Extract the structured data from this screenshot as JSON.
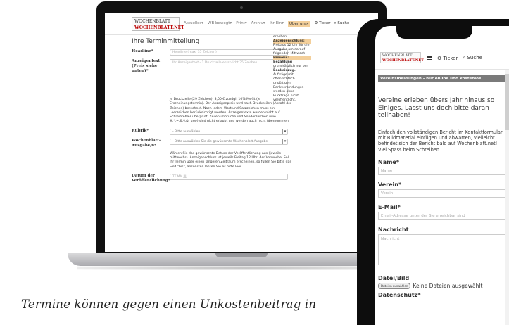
{
  "laptop": {
    "logo": [
      "WOCHENBLATT",
      "WOCHENBLATT.NET"
    ],
    "nav": [
      "Aktuelles▾",
      "WB bewegt▾",
      "Print▾",
      "Archiv▾",
      "Ihr Ein▾",
      "Uber uns▾"
    ],
    "nav_right": [
      "⚙ Ticker",
      "⌕ Suche"
    ],
    "form_title": "Ihre Terminmitteilung",
    "headline_label": "Headline*",
    "headline_placeholder": "Headline (max. 35 Zeichen)",
    "anzeigentext_label": "Anzeigentext (Preis siehe unten)*",
    "anzeigentext_placeholder": "Ihr Anzeigentext - 1 Druckzeile entspricht 35 Zeichen",
    "help_price": "Je Druckzeile (29 Zeichen): 3,00 € zuzügl. 10% MwSt (je Erscheinungstermin). Der Anzeigenpreis wird nach Druckzeilen (Anzahl der Zeichen) berechnet. Nach jedem Wort und Satzzeichen muss ein Leerzeichen berücksichtigt werden. Anzeigentexte werden nicht auf Schreibfehler überprüft. Zeilenumbrüche und Sonderzeichen (wie #,*,~,&,§,&, usw) sind nicht erlaubt und werden auch nicht übernommen.",
    "rubrik_label": "Rubrik*",
    "rubrik_value": "- Bitte auswählen",
    "ausgabe_label": "Wochenblatt-Ausgabe/n*",
    "ausgabe_value": "- Bitte auswählen Sie die gewünschte Wochenblatt Ausgabe -",
    "help_date": "Wählen Sie das gewünschte Datum der Veröffentlichung aus (jeweils mittwochs). Anzeigenschluss ist jeweils Freitag 12 Uhr, der Vorwoche. Soll Ihr Termin über einen längeren Zeitraum erscheinen, so füllen Sie bitte das Feld \"bis\", ansonsten lassen Sie es bitte leer.",
    "datum_label": "Datum der Veröffentlichung*",
    "datum_placeholder": "TT.MM.JJJJ",
    "side": {
      "intro": "erhoben.",
      "schluss_label": "Anzeigenschluss:",
      "schluss_text": "Freitags 12 Uhr für die Ausgabe am darauf folgenden Mittwoch",
      "hinweis_label": "Hinweis:",
      "hinweis_head": "Bezahlung",
      "hinweis_text": "grundsätzlich nur per",
      "einzug": "Bankeinzug.",
      "rest": "Aufträge mit offensichtlich ungültigen Bankverbindungen werden ohne Rückfrage nicht veröffentlicht."
    }
  },
  "phone": {
    "logo": [
      "WOCHENBLATT",
      "WOCHENBLATT.NET"
    ],
    "nav_ticker": "⚙ Ticker",
    "nav_suche": "⌕ Suche",
    "banner": "Vereinsmeldungen - nur online und kostenlos",
    "intro": "Vereine erleben übers Jahr hinaus so Einiges. Lasst uns doch bitte daran teilhaben!",
    "detail": "Einfach den vollständigen Bericht im Kontaktformular mit Bildmaterial einfügen und abwarten, vielleicht befindet sich der Bericht bald auf Wochenblatt.net! Viel Spass beim Schreiben.",
    "name_label": "Name*",
    "name_placeholder": "Name",
    "verein_label": "Verein*",
    "verein_placeholder": "Verein",
    "email_label": "E-Mail*",
    "email_placeholder": "Email-Adresse unter der Sie erreichbar sind",
    "nachricht_label": "Nachricht",
    "nachricht_placeholder": "Nachricht",
    "datei_label": "Datei/Bild",
    "file_button": "Dateien auswählen",
    "file_status": "Keine Dateien ausgewählt",
    "datenschutz_label": "Datenschutz*"
  },
  "caption": "Termine können gegen einen Unkostenbeitrag in"
}
